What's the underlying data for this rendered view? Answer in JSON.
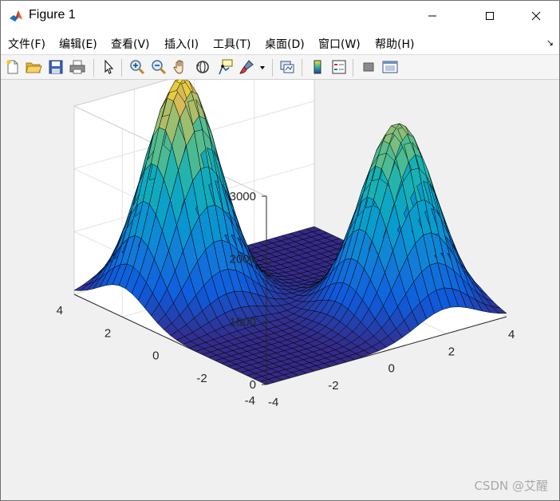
{
  "window": {
    "title": "Figure 1",
    "minimize_icon": "minimize-icon",
    "maximize_icon": "maximize-icon",
    "close_icon": "close-icon"
  },
  "menu": {
    "items": [
      "文件(F)",
      "编辑(E)",
      "查看(V)",
      "插入(I)",
      "工具(T)",
      "桌面(D)",
      "窗口(W)",
      "帮助(H)"
    ],
    "dock_arrow": "↘"
  },
  "toolbar": {
    "icons": [
      "new-figure-icon",
      "open-file-icon",
      "save-icon",
      "print-icon",
      "pointer-icon",
      "zoom-in-icon",
      "zoom-out-icon",
      "pan-icon",
      "rotate-3d-icon",
      "data-cursor-icon",
      "brush-icon",
      "link-plot-icon",
      "colorbar-icon",
      "legend-icon",
      "hide-plot-tools-icon",
      "show-plot-tools-icon"
    ]
  },
  "chart_data": {
    "type": "surface",
    "title": "",
    "x": {
      "ticks": [
        -4,
        -2,
        0,
        2,
        4
      ],
      "lim": [
        -4,
        4
      ]
    },
    "y": {
      "ticks": [
        -4,
        -2,
        0,
        2,
        4
      ],
      "lim": [
        -4,
        4
      ]
    },
    "z": {
      "ticks": [
        0,
        1000,
        2000,
        3000
      ],
      "lim": [
        0,
        3000
      ]
    },
    "grid": true,
    "colormap": "parula",
    "peaks": [
      {
        "x": -2,
        "y": 2,
        "height": 3550
      },
      {
        "x": 2,
        "y": -2,
        "height": 3000
      }
    ],
    "colors": {
      "low": "#352a87",
      "mid": "#1fb7b0",
      "high": "#f9fb0e"
    }
  },
  "watermark": "CSDN @艾醒"
}
